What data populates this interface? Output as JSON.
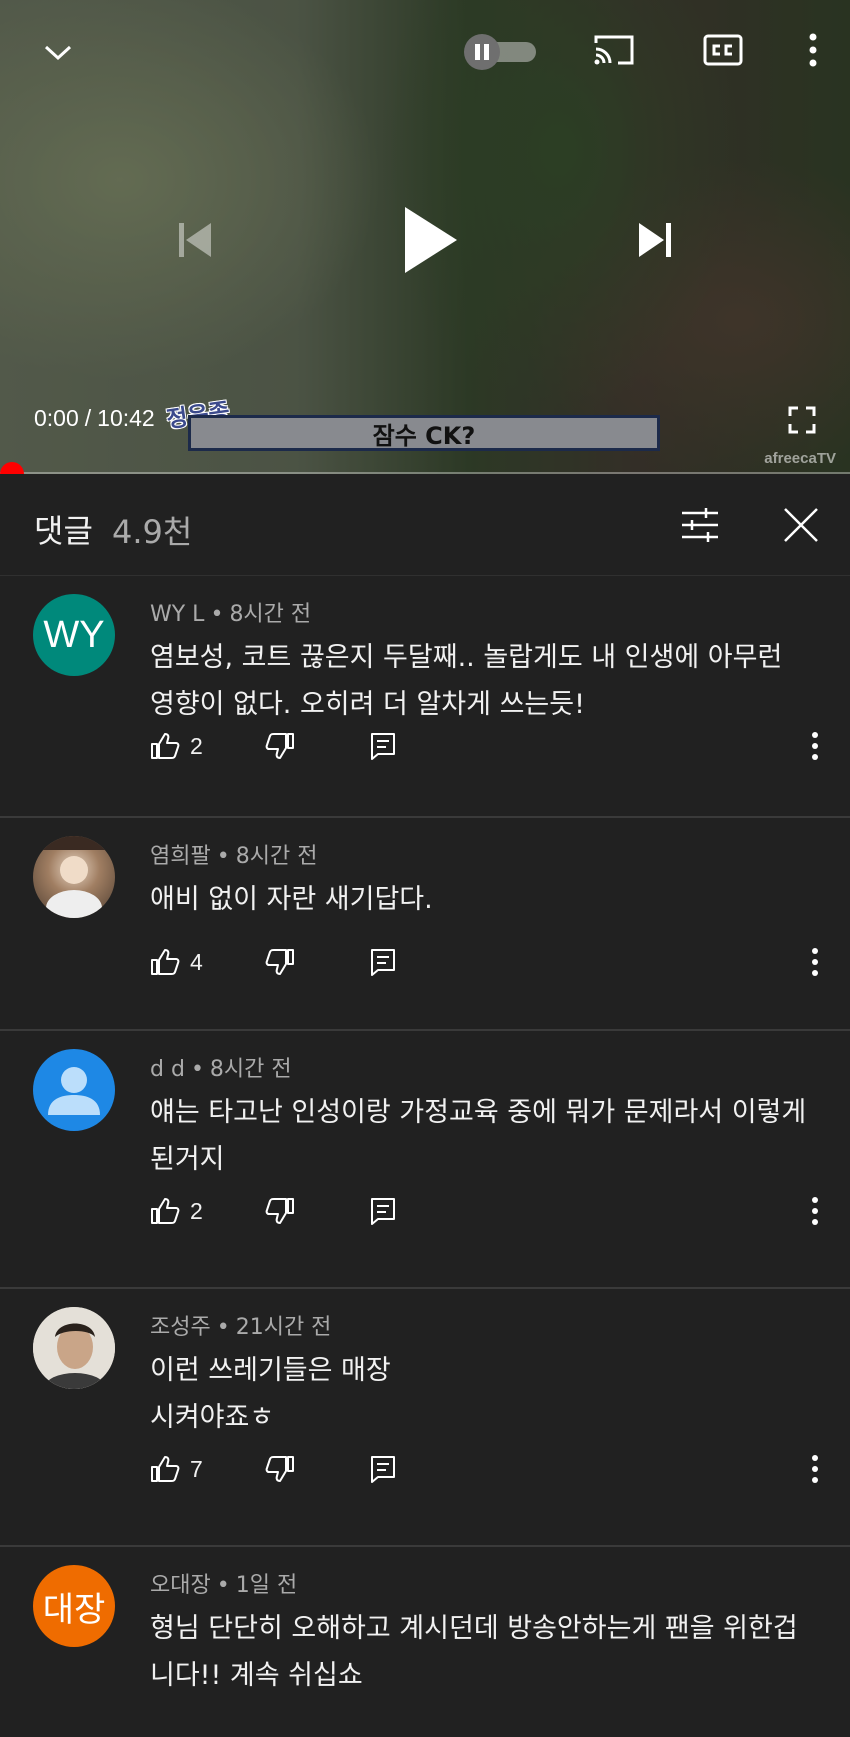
{
  "player": {
    "time_current": "0:00",
    "time_separator": "/",
    "time_total": "10:42",
    "streamer_tag": "정윤종",
    "caption": "잠수 CK?",
    "watermark": "afreecaTV",
    "progress": 0.0,
    "autoplay_on": false
  },
  "comments_header": {
    "title": "댓글",
    "count": "4.9천"
  },
  "comments": [
    {
      "avatar_text": "WY",
      "avatar_color": "#00897b",
      "author": "WY L",
      "time": "8시간 전",
      "text": "염보성, 코트 끊은지 두달째.. 놀랍게도 내 인생에 아무런 영향이 없다. 오히려 더 알차게 쓰는듯!",
      "likes": "2"
    },
    {
      "avatar_text": "",
      "avatar_color": "#8a6e58",
      "author": "염희팔",
      "time": "8시간 전",
      "text": "애비 없이 자란 새기답다.",
      "likes": "4"
    },
    {
      "avatar_text": "",
      "avatar_color": "#1e88e5",
      "author": "d d",
      "time": "8시간 전",
      "text": "얘는 타고난 인성이랑 가정교육 중에 뭐가 문제라서 이렇게 된거지",
      "likes": "2"
    },
    {
      "avatar_text": "",
      "avatar_color": "#d8d4cc",
      "author": "조성주",
      "time": "21시간 전",
      "text_lines": [
        "이런 쓰레기들은 매장",
        "시켜야죠ㅎ"
      ],
      "likes": "7"
    },
    {
      "avatar_text": "대장",
      "avatar_color": "#ef6c00",
      "author": "오대장",
      "time": "1일 전",
      "text": "형님 단단히 오해하고 계시던데 방송안하는게 팬을 위한겁니다!! 계속 쉬십쇼",
      "likes": ""
    }
  ],
  "icons": {
    "collapse": "chevron-down-icon",
    "autoplay": "pause-icon",
    "cast": "cast-icon",
    "captions": "cc-icon",
    "more": "more-vert-icon",
    "previous": "skip-previous-icon",
    "play": "play-icon",
    "next": "skip-next-icon",
    "fullscreen": "fullscreen-icon",
    "sort": "sort-icon",
    "close": "close-icon",
    "like": "thumb-up-icon",
    "dislike": "thumb-down-icon",
    "reply": "reply-icon"
  }
}
